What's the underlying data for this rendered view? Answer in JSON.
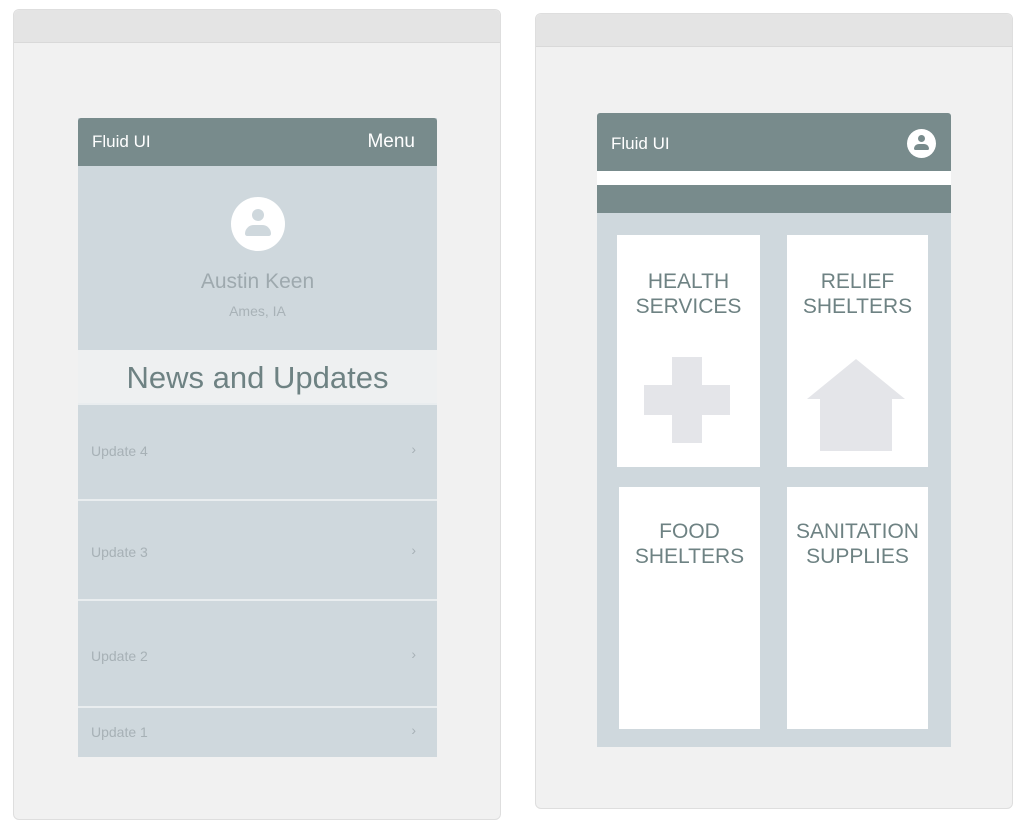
{
  "left_screen": {
    "brand": "Fluid UI",
    "menu_label": "Menu",
    "profile": {
      "name": "Austin Keen",
      "location": "Ames, IA"
    },
    "news_heading": "News and Updates",
    "updates": [
      {
        "label": "Update 4",
        "chevron": "›"
      },
      {
        "label": "Update 3",
        "chevron": "›"
      },
      {
        "label": "Update 2",
        "chevron": "›"
      },
      {
        "label": "Update 1",
        "chevron": "›"
      }
    ]
  },
  "right_screen": {
    "brand": "Fluid UI",
    "tiles": [
      {
        "line1": "HEALTH",
        "line2": "SERVICES",
        "icon": "medical-cross-icon"
      },
      {
        "line1": "RELIEF",
        "line2": "SHELTERS",
        "icon": "house-icon"
      },
      {
        "line1": "FOOD",
        "line2": "SHELTERS"
      },
      {
        "line1": "SANITATION",
        "line2": "SUPPLIES"
      }
    ]
  },
  "colors": {
    "header": "#788b8c",
    "panel": "#cfd8dd",
    "text_accent": "#6e8283",
    "icon_fill": "#e4e5e9"
  }
}
